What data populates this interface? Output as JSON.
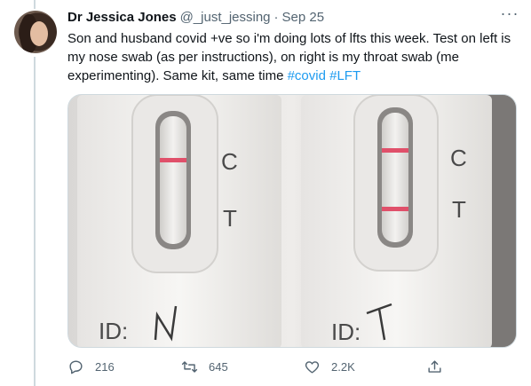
{
  "tweet": {
    "author_name": "Dr Jessica Jones",
    "handle": "@_just_jessing",
    "separator": "·",
    "date": "Sep 25",
    "text_main": "Son and husband covid +ve so i'm doing lots of lfts this week. Test on left is my nose swab (as per instructions), on right is my throat swab (me experimenting). Same kit, same time ",
    "hashtag_1": "#covid",
    "hashtag_2": "#LFT",
    "more_label": "···"
  },
  "media": {
    "left_test": {
      "c_label": "C",
      "t_label": "T",
      "id_label": "ID:",
      "id_mark": "N"
    },
    "right_test": {
      "c_label": "C",
      "t_label": "T",
      "id_label": "ID:",
      "id_mark": "T"
    }
  },
  "actions": {
    "reply_count": "216",
    "retweet_count": "645",
    "like_count": "2.2K"
  },
  "colors": {
    "accent": "#1d9bf0",
    "secondary_text": "#536471",
    "test_line": "#e0506a"
  }
}
